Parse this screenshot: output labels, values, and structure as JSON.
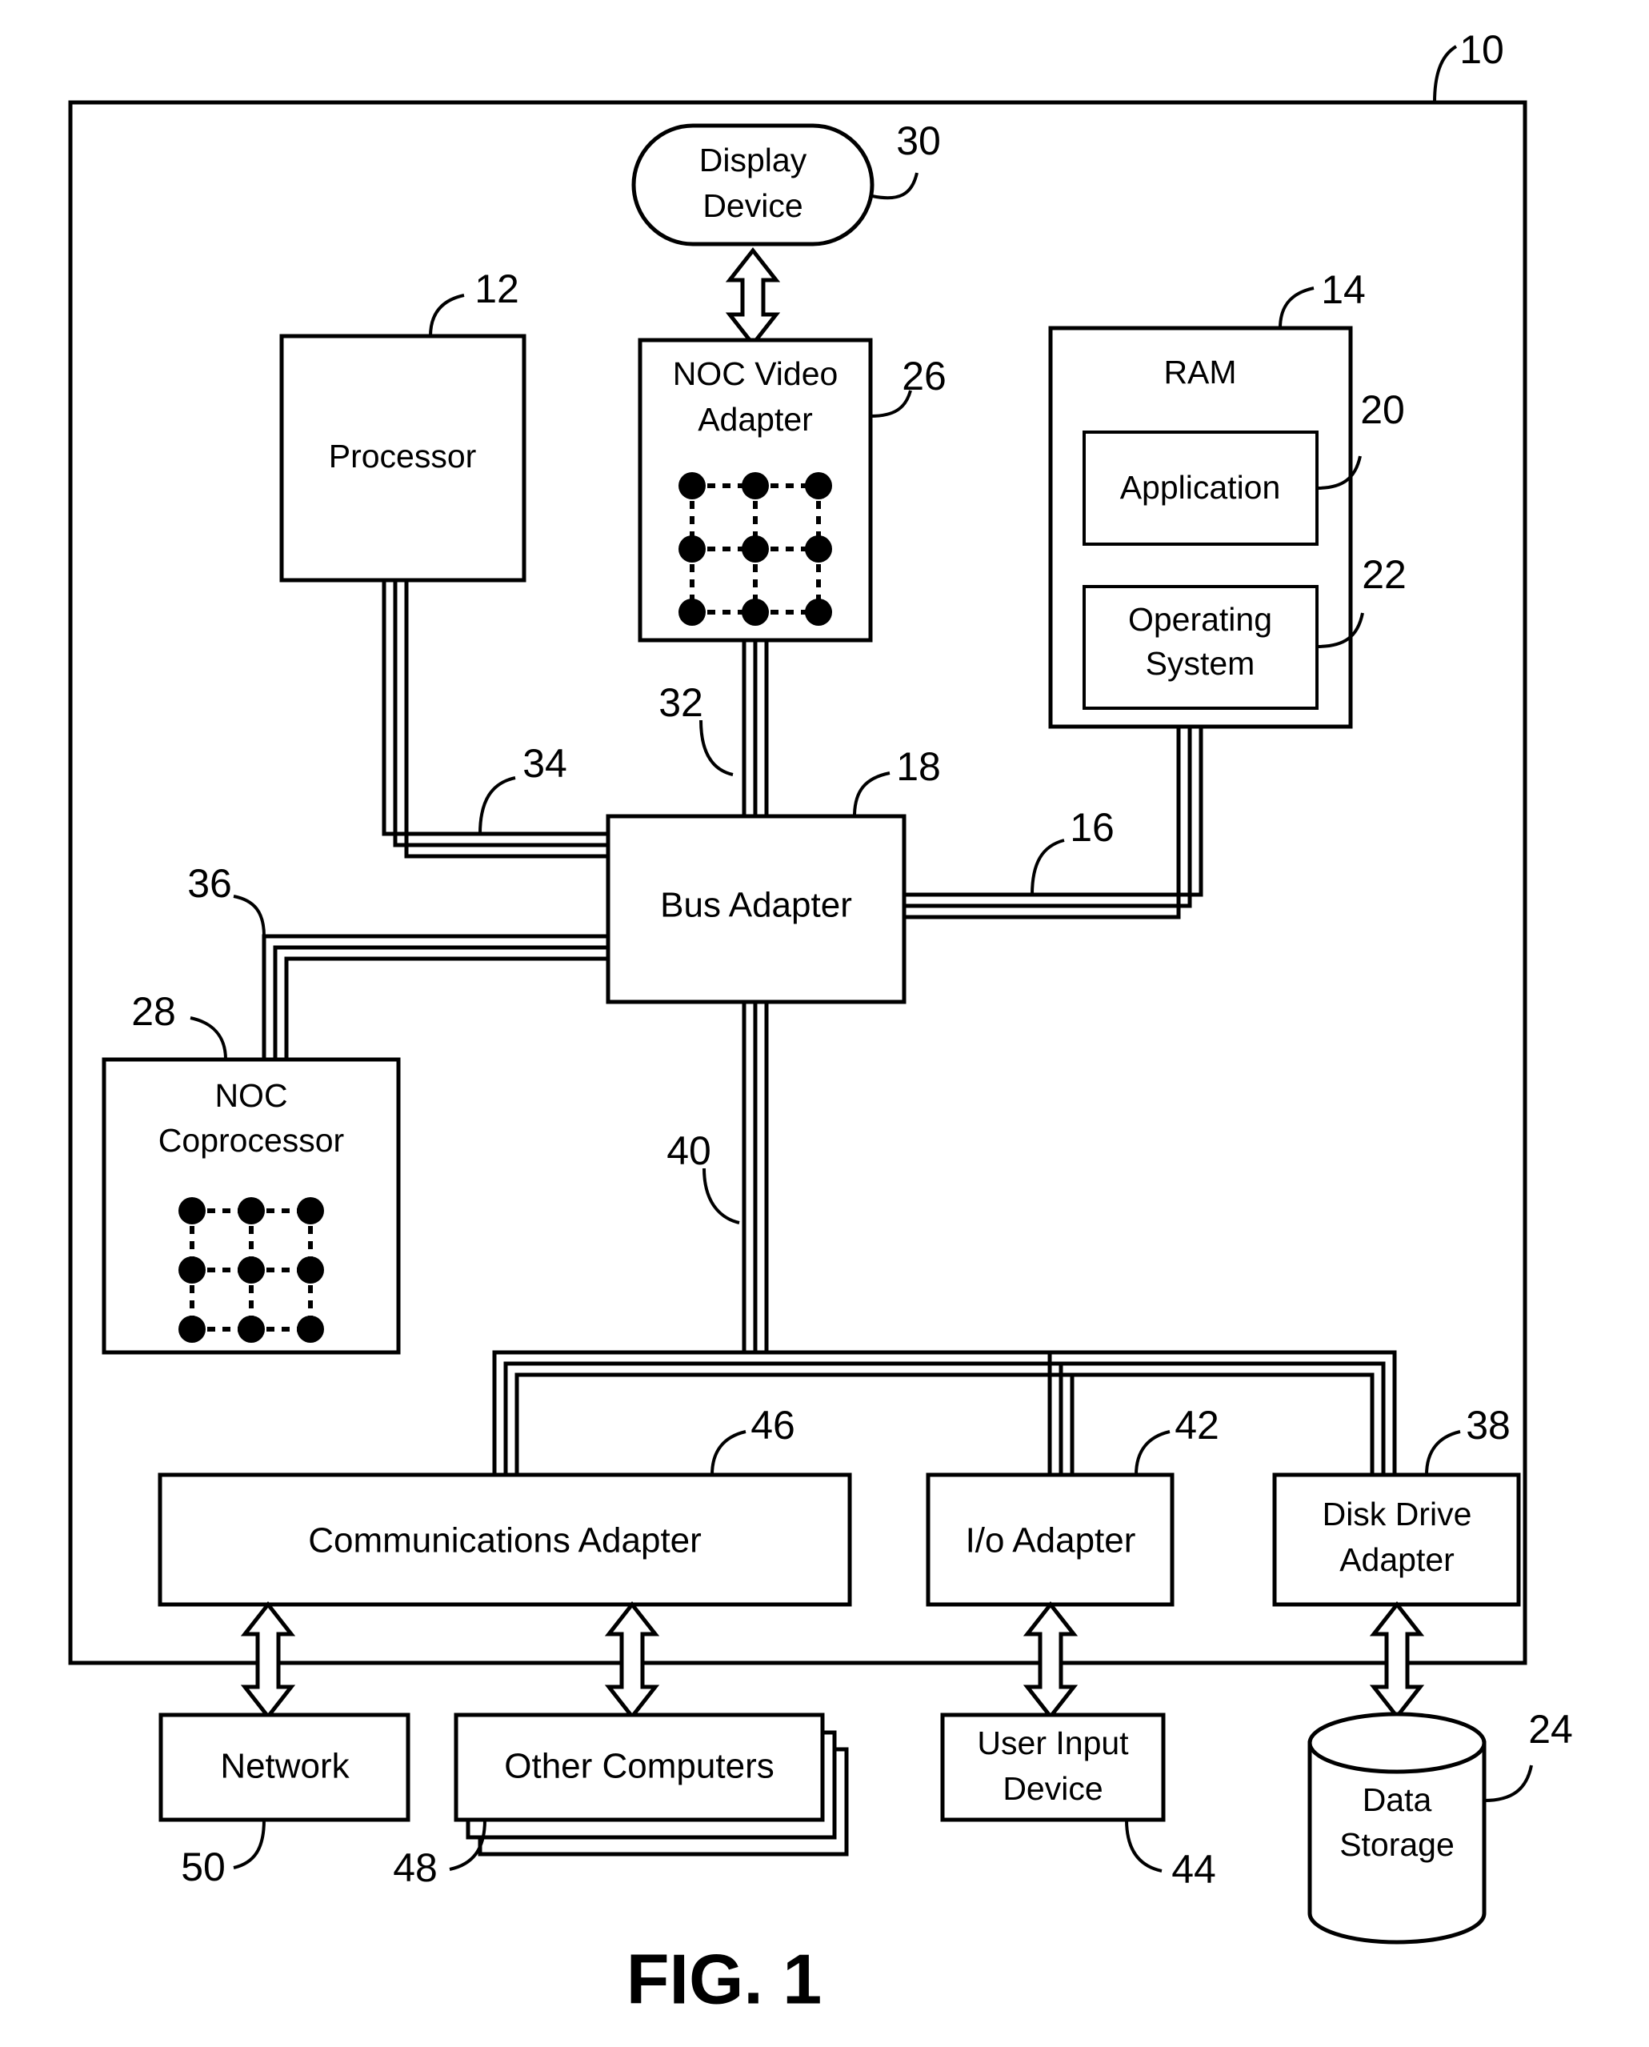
{
  "figure": {
    "caption": "FIG. 1",
    "outer_ref": "10"
  },
  "blocks": {
    "display_device": {
      "line1": "Display",
      "line2": "Device",
      "ref": "30"
    },
    "processor": {
      "label": "Processor",
      "ref": "12"
    },
    "noc_video_adapter": {
      "line1": "NOC Video",
      "line2": "Adapter",
      "ref": "26"
    },
    "ram": {
      "label": "RAM",
      "ref": "14"
    },
    "application": {
      "label": "Application",
      "ref": "20"
    },
    "operating_system": {
      "line1": "Operating",
      "line2": "System",
      "ref": "22"
    },
    "bus_adapter": {
      "label": "Bus Adapter",
      "ref": "18"
    },
    "noc_coprocessor": {
      "line1": "NOC",
      "line2": "Coprocessor",
      "ref": "28"
    },
    "communications_adapter": {
      "label": "Communications Adapter",
      "ref": "46"
    },
    "io_adapter": {
      "label": "I/o Adapter",
      "ref": "42"
    },
    "disk_drive_adapter": {
      "line1": "Disk Drive",
      "line2": "Adapter",
      "ref": "38"
    },
    "network": {
      "label": "Network",
      "ref": "50"
    },
    "other_computers": {
      "label": "Other Computers",
      "ref": "48"
    },
    "user_input_device": {
      "line1": "User Input",
      "line2": "Device",
      "ref": "44"
    },
    "data_storage": {
      "line1": "Data",
      "line2": "Storage",
      "ref": "24"
    }
  },
  "bus_refs": {
    "memory_bus": "16",
    "front_side_bus_video": "32",
    "front_side_bus_processor": "34",
    "front_side_bus_coprocessor": "36",
    "expansion_bus": "40"
  },
  "colors": {
    "ink": "#000000",
    "paper": "#ffffff"
  }
}
